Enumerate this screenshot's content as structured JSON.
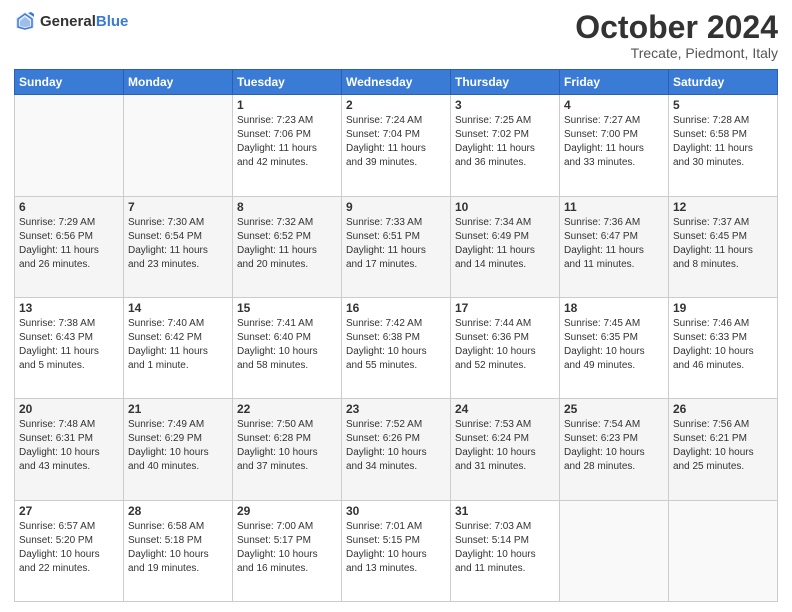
{
  "header": {
    "logo_general": "General",
    "logo_blue": "Blue",
    "month": "October 2024",
    "location": "Trecate, Piedmont, Italy"
  },
  "days_of_week": [
    "Sunday",
    "Monday",
    "Tuesday",
    "Wednesday",
    "Thursday",
    "Friday",
    "Saturday"
  ],
  "weeks": [
    {
      "cells": [
        {
          "day": null,
          "info": null
        },
        {
          "day": null,
          "info": null
        },
        {
          "day": "1",
          "info": "Sunrise: 7:23 AM\nSunset: 7:06 PM\nDaylight: 11 hours\nand 42 minutes."
        },
        {
          "day": "2",
          "info": "Sunrise: 7:24 AM\nSunset: 7:04 PM\nDaylight: 11 hours\nand 39 minutes."
        },
        {
          "day": "3",
          "info": "Sunrise: 7:25 AM\nSunset: 7:02 PM\nDaylight: 11 hours\nand 36 minutes."
        },
        {
          "day": "4",
          "info": "Sunrise: 7:27 AM\nSunset: 7:00 PM\nDaylight: 11 hours\nand 33 minutes."
        },
        {
          "day": "5",
          "info": "Sunrise: 7:28 AM\nSunset: 6:58 PM\nDaylight: 11 hours\nand 30 minutes."
        }
      ]
    },
    {
      "cells": [
        {
          "day": "6",
          "info": "Sunrise: 7:29 AM\nSunset: 6:56 PM\nDaylight: 11 hours\nand 26 minutes."
        },
        {
          "day": "7",
          "info": "Sunrise: 7:30 AM\nSunset: 6:54 PM\nDaylight: 11 hours\nand 23 minutes."
        },
        {
          "day": "8",
          "info": "Sunrise: 7:32 AM\nSunset: 6:52 PM\nDaylight: 11 hours\nand 20 minutes."
        },
        {
          "day": "9",
          "info": "Sunrise: 7:33 AM\nSunset: 6:51 PM\nDaylight: 11 hours\nand 17 minutes."
        },
        {
          "day": "10",
          "info": "Sunrise: 7:34 AM\nSunset: 6:49 PM\nDaylight: 11 hours\nand 14 minutes."
        },
        {
          "day": "11",
          "info": "Sunrise: 7:36 AM\nSunset: 6:47 PM\nDaylight: 11 hours\nand 11 minutes."
        },
        {
          "day": "12",
          "info": "Sunrise: 7:37 AM\nSunset: 6:45 PM\nDaylight: 11 hours\nand 8 minutes."
        }
      ]
    },
    {
      "cells": [
        {
          "day": "13",
          "info": "Sunrise: 7:38 AM\nSunset: 6:43 PM\nDaylight: 11 hours\nand 5 minutes."
        },
        {
          "day": "14",
          "info": "Sunrise: 7:40 AM\nSunset: 6:42 PM\nDaylight: 11 hours\nand 1 minute."
        },
        {
          "day": "15",
          "info": "Sunrise: 7:41 AM\nSunset: 6:40 PM\nDaylight: 10 hours\nand 58 minutes."
        },
        {
          "day": "16",
          "info": "Sunrise: 7:42 AM\nSunset: 6:38 PM\nDaylight: 10 hours\nand 55 minutes."
        },
        {
          "day": "17",
          "info": "Sunrise: 7:44 AM\nSunset: 6:36 PM\nDaylight: 10 hours\nand 52 minutes."
        },
        {
          "day": "18",
          "info": "Sunrise: 7:45 AM\nSunset: 6:35 PM\nDaylight: 10 hours\nand 49 minutes."
        },
        {
          "day": "19",
          "info": "Sunrise: 7:46 AM\nSunset: 6:33 PM\nDaylight: 10 hours\nand 46 minutes."
        }
      ]
    },
    {
      "cells": [
        {
          "day": "20",
          "info": "Sunrise: 7:48 AM\nSunset: 6:31 PM\nDaylight: 10 hours\nand 43 minutes."
        },
        {
          "day": "21",
          "info": "Sunrise: 7:49 AM\nSunset: 6:29 PM\nDaylight: 10 hours\nand 40 minutes."
        },
        {
          "day": "22",
          "info": "Sunrise: 7:50 AM\nSunset: 6:28 PM\nDaylight: 10 hours\nand 37 minutes."
        },
        {
          "day": "23",
          "info": "Sunrise: 7:52 AM\nSunset: 6:26 PM\nDaylight: 10 hours\nand 34 minutes."
        },
        {
          "day": "24",
          "info": "Sunrise: 7:53 AM\nSunset: 6:24 PM\nDaylight: 10 hours\nand 31 minutes."
        },
        {
          "day": "25",
          "info": "Sunrise: 7:54 AM\nSunset: 6:23 PM\nDaylight: 10 hours\nand 28 minutes."
        },
        {
          "day": "26",
          "info": "Sunrise: 7:56 AM\nSunset: 6:21 PM\nDaylight: 10 hours\nand 25 minutes."
        }
      ]
    },
    {
      "cells": [
        {
          "day": "27",
          "info": "Sunrise: 6:57 AM\nSunset: 5:20 PM\nDaylight: 10 hours\nand 22 minutes."
        },
        {
          "day": "28",
          "info": "Sunrise: 6:58 AM\nSunset: 5:18 PM\nDaylight: 10 hours\nand 19 minutes."
        },
        {
          "day": "29",
          "info": "Sunrise: 7:00 AM\nSunset: 5:17 PM\nDaylight: 10 hours\nand 16 minutes."
        },
        {
          "day": "30",
          "info": "Sunrise: 7:01 AM\nSunset: 5:15 PM\nDaylight: 10 hours\nand 13 minutes."
        },
        {
          "day": "31",
          "info": "Sunrise: 7:03 AM\nSunset: 5:14 PM\nDaylight: 10 hours\nand 11 minutes."
        },
        {
          "day": null,
          "info": null
        },
        {
          "day": null,
          "info": null
        }
      ]
    }
  ]
}
